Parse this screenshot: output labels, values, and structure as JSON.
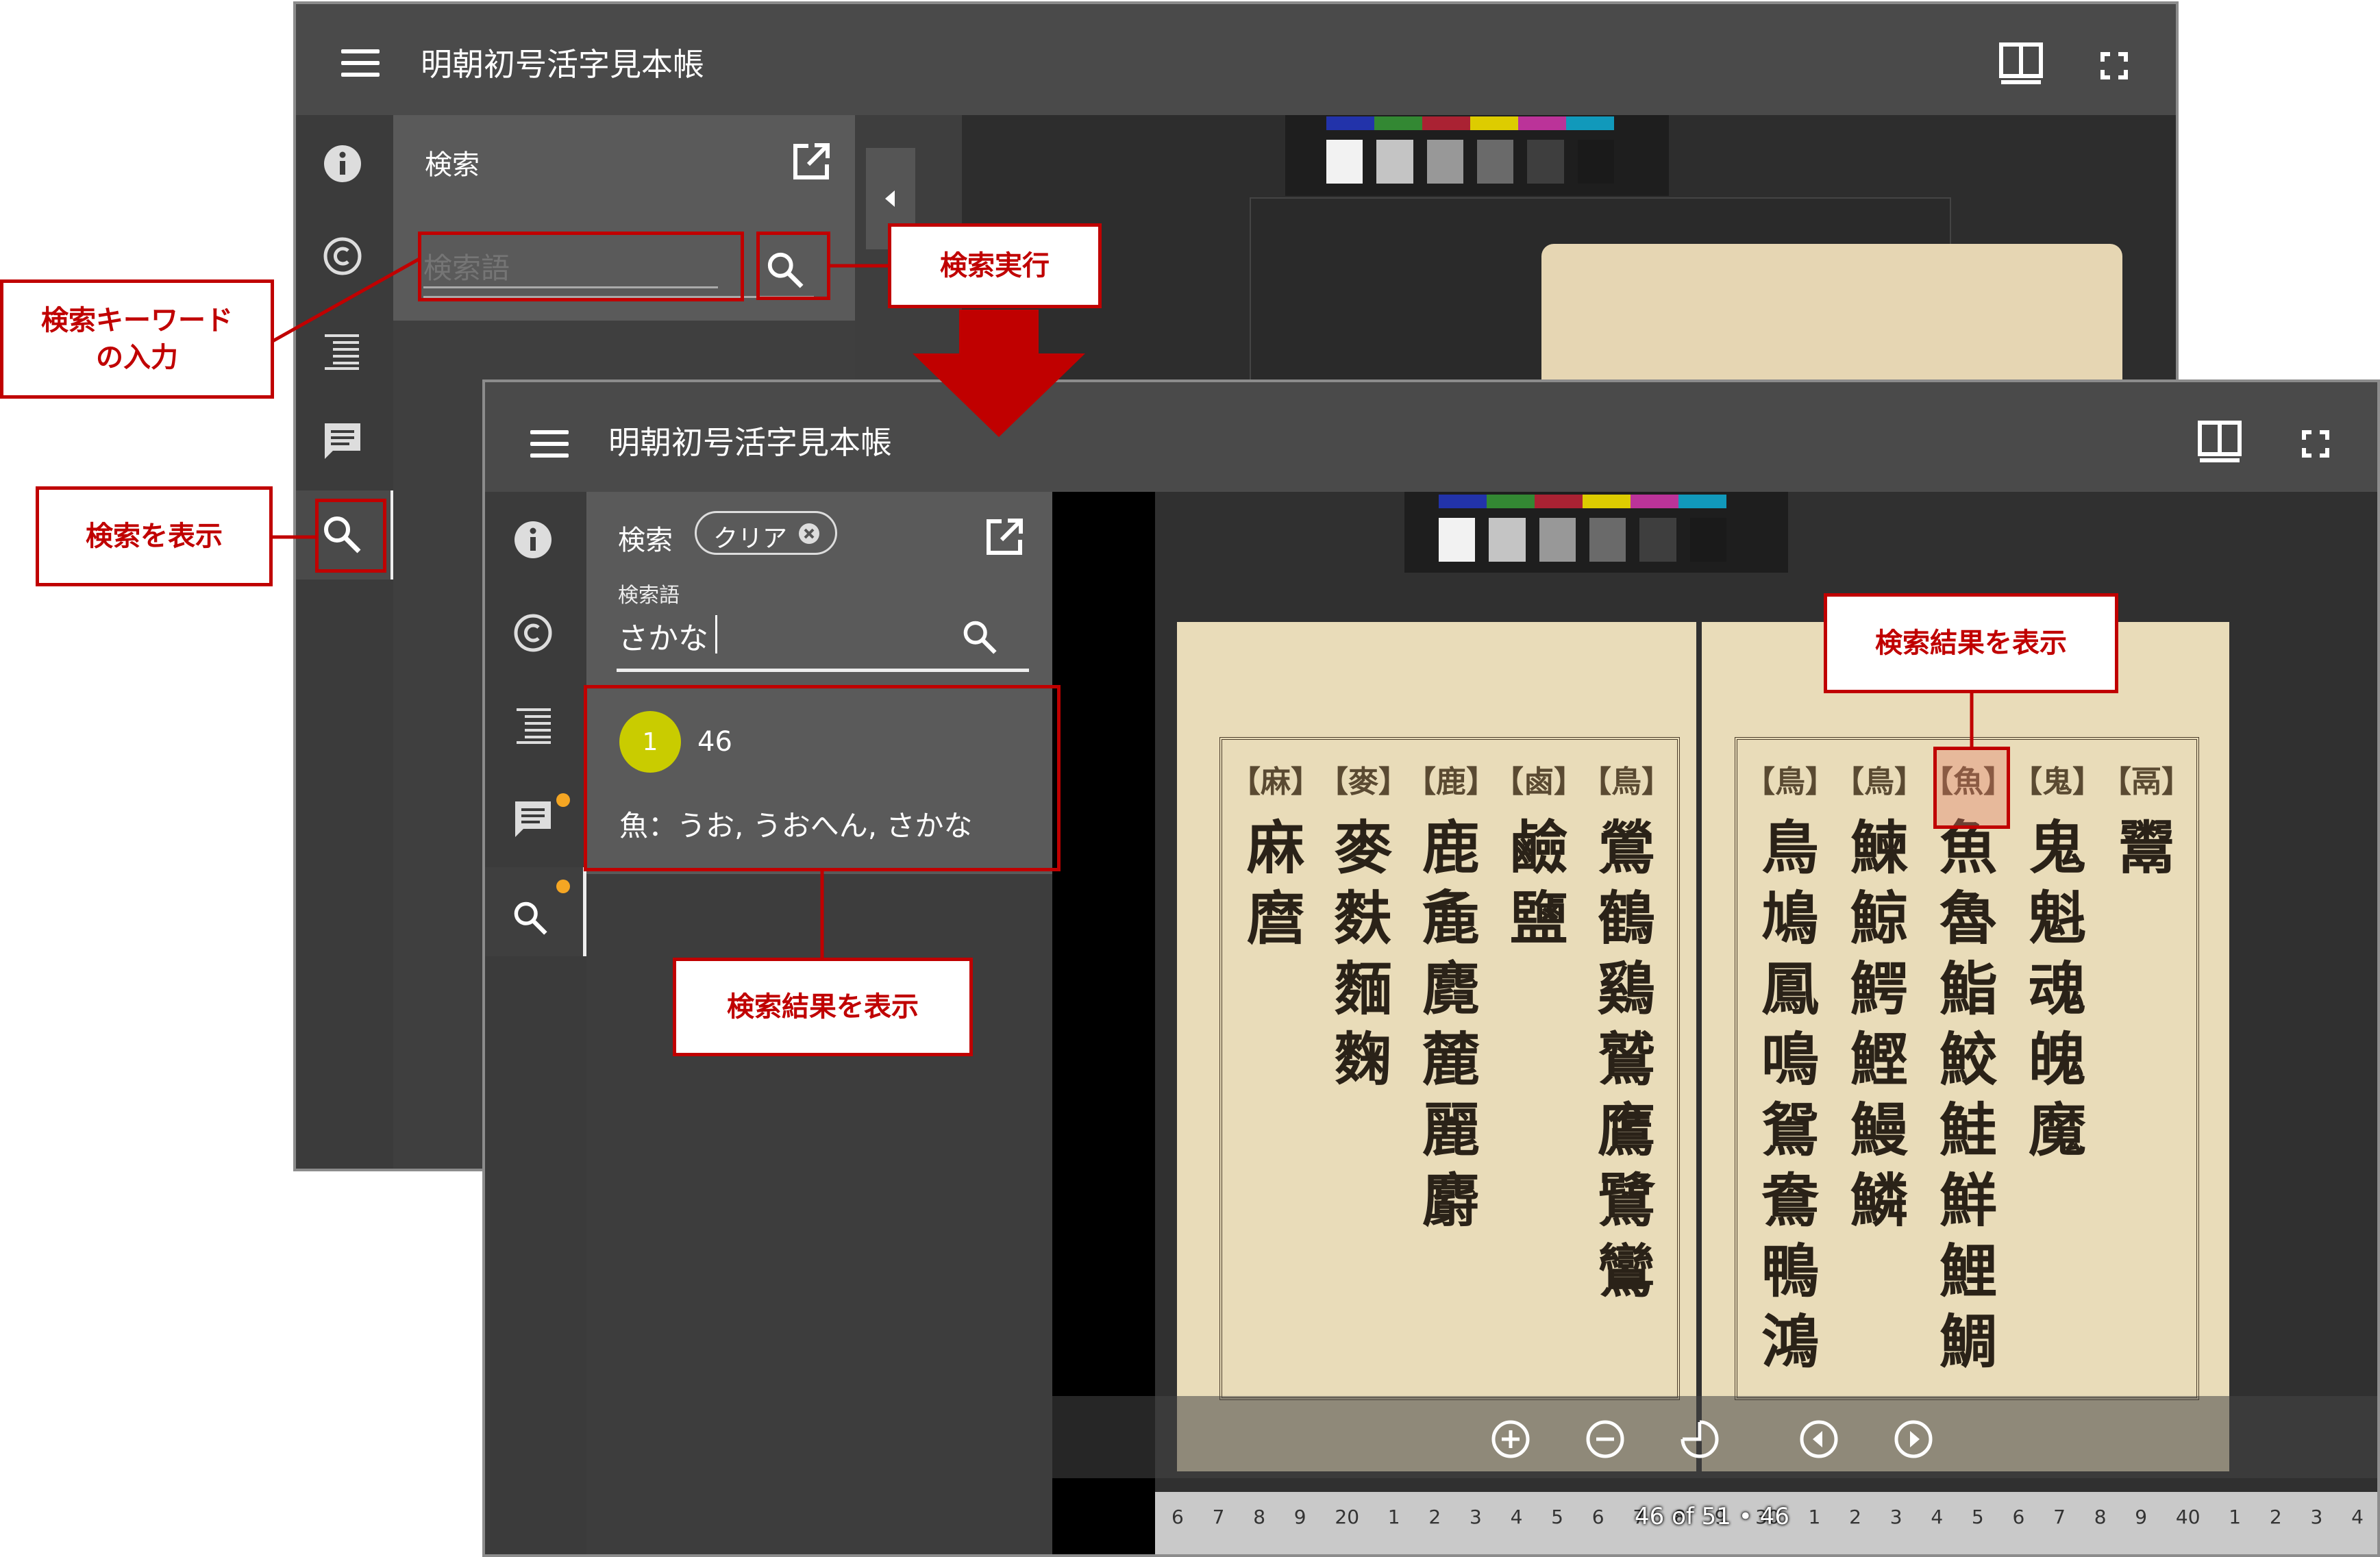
{
  "app_title": "明朝初号活字見本帳",
  "panel_title": "検索",
  "clear_chip": "クリア",
  "search_placeholder": "検索語",
  "search_label": "検索語",
  "search_value": "さかな",
  "result": {
    "badge": "1",
    "page": "46",
    "snippet": "魚：うお, うおへん, さかな"
  },
  "page_counter": "46 of 51 • 46",
  "annotations": {
    "keyword_input": "検索キーワード\nの入力",
    "show_search": "検索を表示",
    "run_search": "検索実行",
    "show_results_panel": "検索結果を表示",
    "show_results_page": "検索結果を表示"
  },
  "ruler_digits": [
    "6",
    "7",
    "8",
    "9",
    "20",
    "1",
    "2",
    "3",
    "4",
    "5",
    "6",
    "7",
    "8",
    "9",
    "30",
    "1",
    "2",
    "3",
    "4",
    "5",
    "6",
    "7",
    "8",
    "9",
    "40",
    "1",
    "2",
    "3",
    "4"
  ],
  "right_page_headers": [
    "鳥",
    "鳥",
    "魚",
    "鬼",
    "鬲"
  ],
  "right_page_columns": [
    [
      "鳥",
      "鳩",
      "鳳",
      "鳴",
      "鴛",
      "鴦",
      "鴨",
      "鴻"
    ],
    [
      "鰊",
      "鯨",
      "鰐",
      "鰹",
      "鰻",
      "鱗"
    ],
    [
      "魚",
      "魯",
      "鮨",
      "鮫",
      "鮭",
      "鮮",
      "鯉",
      "鯛"
    ],
    [
      "鬼",
      "魁",
      "魂",
      "魄",
      "魔"
    ],
    [
      "鬻"
    ]
  ],
  "left_page_headers": [
    "麻",
    "麥",
    "鹿",
    "鹵",
    "鳥"
  ],
  "left_page_columns": [
    [
      "麻",
      "麿"
    ],
    [
      "麥",
      "麩",
      "麵",
      "麴"
    ],
    [
      "鹿",
      "麁",
      "麑",
      "麓",
      "麗",
      "麝"
    ],
    [
      "鹼",
      "鹽"
    ],
    [
      "鶯",
      "鶴",
      "鷄",
      "鷲",
      "鷹",
      "鷺",
      "鸞"
    ]
  ],
  "colors": {
    "accent_red": "#c00000",
    "badge_yellow": "#c9cc00",
    "notify_orange": "#f5a623"
  },
  "icons": [
    "menu-icon",
    "book-view-icon",
    "fullscreen-icon",
    "info-icon",
    "copyright-icon",
    "toc-icon",
    "comment-icon",
    "search-icon",
    "open-external-icon",
    "zoom-in-icon",
    "zoom-out-icon",
    "rotate-icon",
    "prev-page-icon",
    "next-page-icon",
    "collapse-icon",
    "clear-icon"
  ]
}
